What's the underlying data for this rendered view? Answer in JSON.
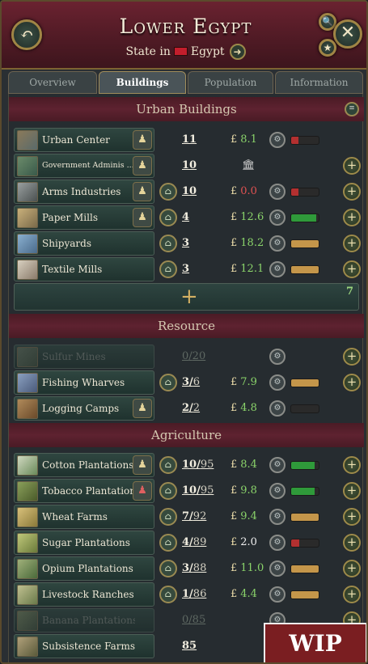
{
  "header": {
    "title": "Lower Egypt",
    "subtitle_prefix": "State in",
    "country": "Egypt",
    "flag_color": "#c21e2c"
  },
  "tabs": [
    {
      "label": "Overview",
      "active": false
    },
    {
      "label": "Buildings",
      "active": true
    },
    {
      "label": "Population",
      "active": false
    },
    {
      "label": "Information",
      "active": false
    }
  ],
  "sections": {
    "urban": "Urban Buildings",
    "resource": "Resource",
    "agriculture": "Agriculture"
  },
  "urban_add": {
    "plus": "+",
    "count": "7"
  },
  "currency": "£",
  "urban": [
    {
      "name": "Urban Center",
      "level": "11",
      "money": "8.1",
      "bar": 0.25,
      "bar_color": "#b33030"
    },
    {
      "name": "Government Adminis ...",
      "level": "10",
      "money": "",
      "bar": null
    },
    {
      "name": "Arms Industries",
      "level": "10",
      "money": "0.0",
      "bar": 0.25,
      "bar_color": "#b33030"
    },
    {
      "name": "Paper Mills",
      "level": "4",
      "money": "12.6",
      "bar": 0.9,
      "bar_color": "#2f9a3a"
    },
    {
      "name": "Shipyards",
      "level": "3",
      "money": "18.2",
      "bar": 1.0,
      "bar_color": "#c4964a"
    },
    {
      "name": "Textile Mills",
      "level": "3",
      "money": "12.1",
      "bar": 1.0,
      "bar_color": "#c4964a"
    }
  ],
  "resource": [
    {
      "name": "Sulfur Mines",
      "level": "0",
      "max": "20",
      "money": "",
      "bar": null
    },
    {
      "name": "Fishing Wharves",
      "level": "3",
      "max": "6",
      "money": "7.9",
      "bar": 1.0,
      "bar_color": "#c4964a"
    },
    {
      "name": "Logging Camps",
      "level": "2",
      "max": "2",
      "money": "4.8",
      "bar": 0.0,
      "bar_color": "#333"
    }
  ],
  "agriculture": [
    {
      "name": "Cotton Plantations",
      "level": "10",
      "max": "95",
      "money": "8.4",
      "bar": 0.85,
      "bar_color": "#2f9a3a"
    },
    {
      "name": "Tobacco Plantations",
      "level": "10",
      "max": "95",
      "money": "9.8",
      "bar": 0.85,
      "bar_color": "#2f9a3a"
    },
    {
      "name": "Wheat Farms",
      "level": "7",
      "max": "92",
      "money": "9.4",
      "bar": 1.0,
      "bar_color": "#c4964a"
    },
    {
      "name": "Sugar Plantations",
      "level": "4",
      "max": "89",
      "money": "2.0",
      "bar": 0.3,
      "bar_color": "#b33030"
    },
    {
      "name": "Opium Plantations",
      "level": "3",
      "max": "88",
      "money": "11.0",
      "bar": 1.0,
      "bar_color": "#c4964a"
    },
    {
      "name": "Livestock Ranches",
      "level": "1",
      "max": "86",
      "money": "4.4",
      "bar": 1.0,
      "bar_color": "#c4964a"
    },
    {
      "name": "Banana Plantations",
      "level": "0",
      "max": "85",
      "money": "",
      "bar": null
    },
    {
      "name": "Subsistence Farms",
      "level": "85",
      "money": "",
      "bar": null
    }
  ],
  "badge": "WIP"
}
